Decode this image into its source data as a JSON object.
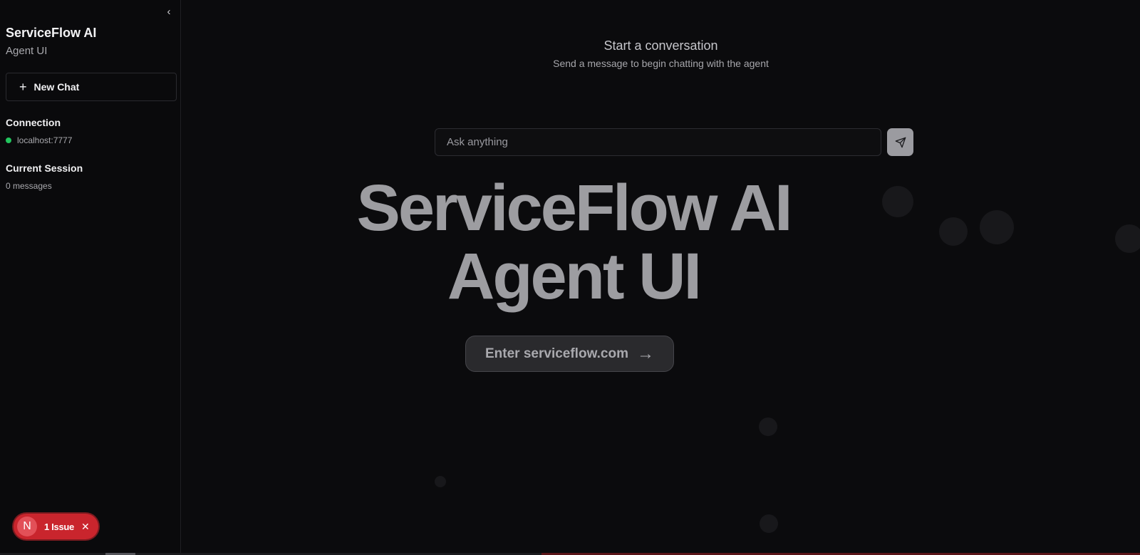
{
  "sidebar": {
    "collapse_icon": "chevron-left-icon",
    "brand_title": "ServiceFlow AI",
    "brand_subtitle": "Agent UI",
    "new_chat_label": "New Chat",
    "connection": {
      "title": "Connection",
      "host": "localhost:7777",
      "status_color": "#22c55e"
    },
    "session": {
      "title": "Current Session",
      "count_text": "0 messages"
    }
  },
  "issue_badge": {
    "initial": "N",
    "label": "1 Issue",
    "color": "#c9252d"
  },
  "main": {
    "empty_title": "Start a conversation",
    "empty_subtitle": "Send a message to begin chatting with the agent",
    "input_placeholder": "Ask anything",
    "send_icon": "send-icon",
    "hero_line1": "ServiceFlow AI",
    "hero_line2": "Agent UI",
    "enter_label": "Enter serviceflow.com",
    "enter_arrow": "→"
  }
}
